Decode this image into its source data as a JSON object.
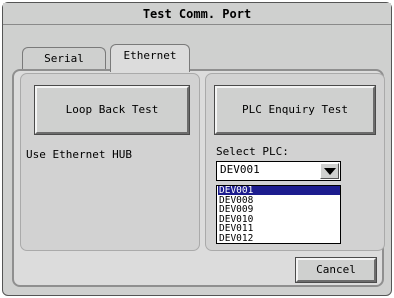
{
  "window": {
    "title": "Test Comm. Port"
  },
  "tabs": [
    {
      "label": "Serial",
      "active": false
    },
    {
      "label": "Ethernet",
      "active": true
    }
  ],
  "left": {
    "loopback_button": "Loop Back Test",
    "note": "Use Ethernet HUB"
  },
  "right": {
    "enquiry_button": "PLC Enquiry Test",
    "select_label": "Select PLC:",
    "selected_value": "DEV001",
    "options": [
      "DEV001",
      "DEV008",
      "DEV009",
      "DEV010",
      "DEV011",
      "DEV012"
    ],
    "highlighted_index": 0
  },
  "footer": {
    "cancel_button": "Cancel"
  },
  "colors": {
    "highlight": "#1c1c8e",
    "panel": "#cfd0cf"
  },
  "icons": {
    "dropdown": "triangle-down-icon"
  }
}
